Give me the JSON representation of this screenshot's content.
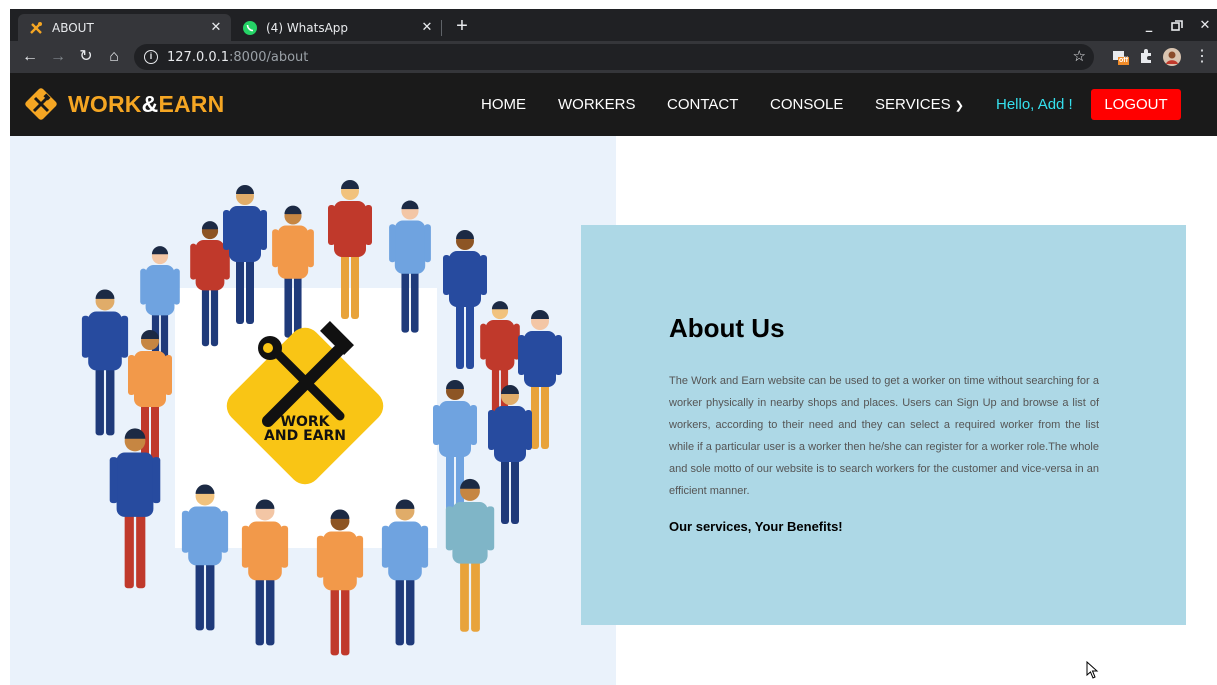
{
  "browser": {
    "tabs": [
      {
        "title": "ABOUT",
        "active": true
      },
      {
        "title": "(4) WhatsApp",
        "active": false
      }
    ],
    "url_host": "127.0.0.1",
    "url_path": ":8000/about",
    "ext_badge": "off"
  },
  "site": {
    "brand_main": "WORK",
    "brand_amp": "&",
    "brand_end": "EARN",
    "nav": [
      "HOME",
      "WORKERS",
      "CONTACT",
      "CONSOLE",
      "SERVICES"
    ],
    "greeting": "Hello, Add !",
    "logout_label": "LOGOUT",
    "logo_line1": "WORK",
    "logo_line2": "AND EARN"
  },
  "about": {
    "title": "About Us",
    "body": "The Work and Earn website can be used to get a worker on time without searching for a worker physically in nearby shops and places. Users can Sign Up and browse a list of workers, according to their need and they can select a required worker from the list while if a particular user is a worker then he/she can register for a worker role.The whole and sole motto of our website is to search workers for the customer and vice-versa in an efficient manner.",
    "subtitle": "Our services, Your Benefits!"
  },
  "colors": {
    "brand_accent": "#f5a623",
    "logout_bg": "#ff0000",
    "greeting": "#35e0ee",
    "about_bg": "#add8e6",
    "hero_bg": "#eaf2fb"
  }
}
